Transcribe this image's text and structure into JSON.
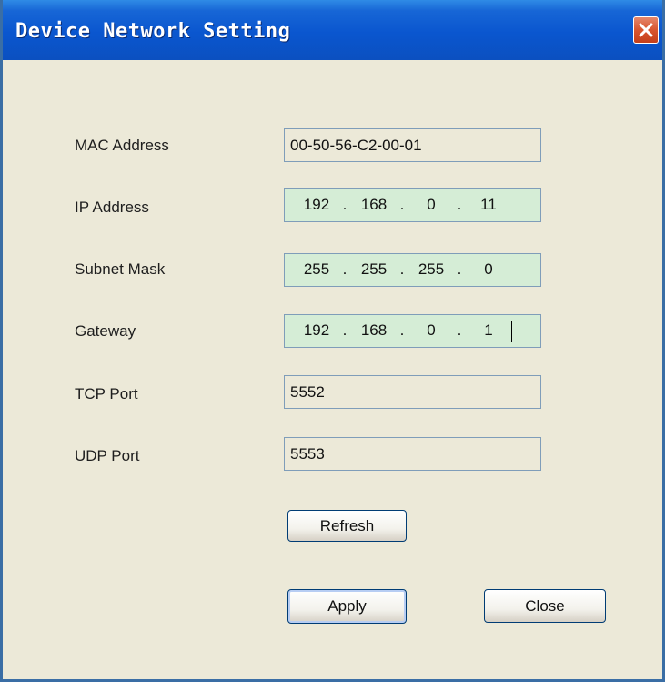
{
  "window": {
    "title": "Device Network Setting"
  },
  "fields": {
    "mac": {
      "label": "MAC Address",
      "value": "00-50-56-C2-00-01"
    },
    "ip": {
      "label": "IP Address",
      "octets": [
        "192",
        "168",
        "0",
        "11"
      ]
    },
    "subnet": {
      "label": "Subnet Mask",
      "octets": [
        "255",
        "255",
        "255",
        "0"
      ]
    },
    "gateway": {
      "label": "Gateway",
      "octets": [
        "192",
        "168",
        "0",
        "1"
      ]
    },
    "tcp": {
      "label": "TCP Port",
      "value": "5552"
    },
    "udp": {
      "label": "UDP Port",
      "value": "5553"
    }
  },
  "buttons": {
    "refresh": "Refresh",
    "apply": "Apply",
    "close": "Close"
  },
  "ip_separator": ".",
  "colors": {
    "titlebar": "#0a56cf",
    "dialog_bg": "#ece9d8",
    "ip_field_bg": "#d5edd6",
    "close_button": "#d8552f"
  },
  "icons": {
    "title_close": "close-icon"
  }
}
